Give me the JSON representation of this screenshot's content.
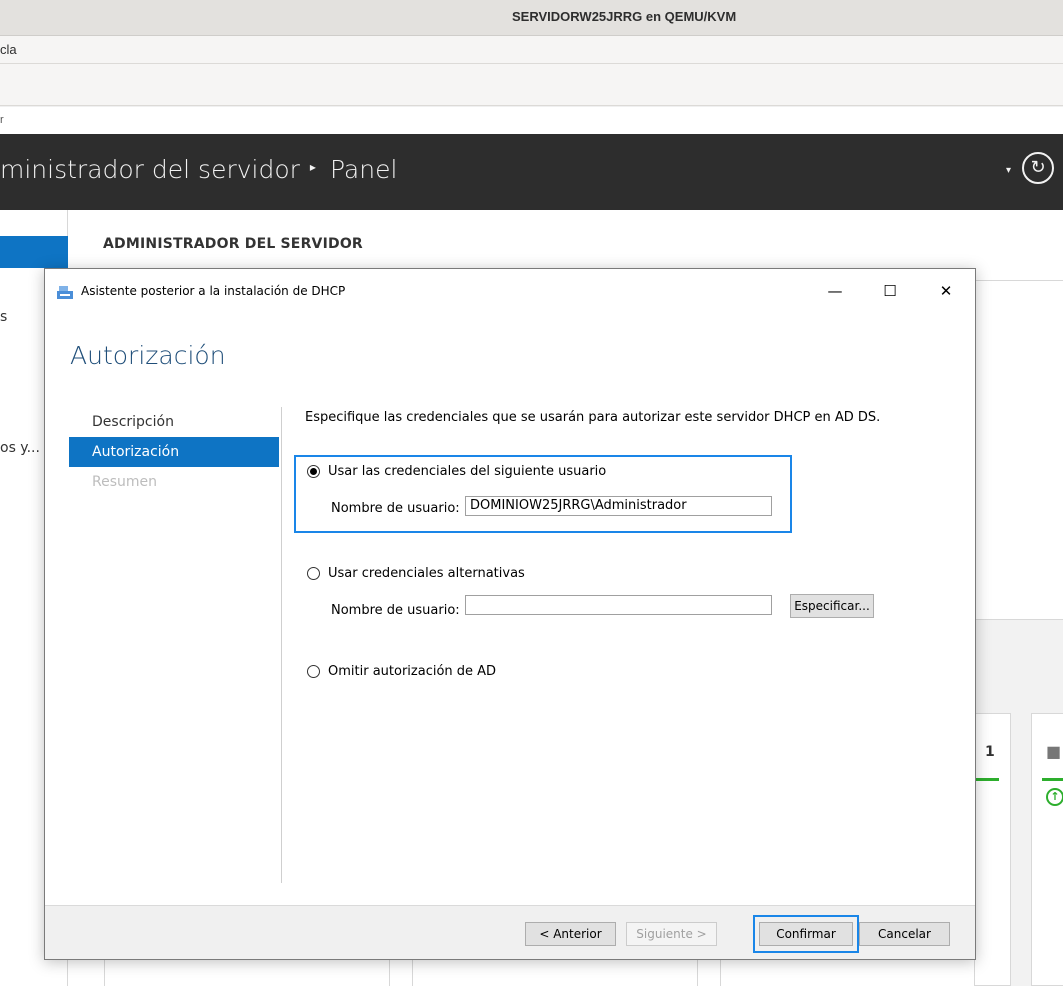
{
  "vm": {
    "window_title": "SERVIDORW25JRRG en QEMU/KVM",
    "menu_visible_text": "cla",
    "titlestrip_text": "r"
  },
  "server_manager": {
    "breadcrumb_root": "ministrador del servidor",
    "breadcrumb_sep": "▸",
    "breadcrumb_page": "Panel",
    "main_title": "ADMINISTRADOR DEL SERVIDOR",
    "nav_fragment_1": "s",
    "nav_fragment_2": "os y...",
    "tile_number": "1",
    "header_arrow": "▾",
    "refresh_glyph": "↻",
    "tile_up_glyph": "↑"
  },
  "dialog": {
    "title": "Asistente posterior a la instalación de DHCP",
    "minimize_glyph": "—",
    "maximize_glyph": "☐",
    "close_glyph": "✕",
    "heading": "Autorización",
    "steps": [
      {
        "label": "Descripción",
        "state": "normal"
      },
      {
        "label": "Autorización",
        "state": "active"
      },
      {
        "label": "Resumen",
        "state": "disabled"
      }
    ],
    "description": "Especifique las credenciales que se usarán para autorizar este servidor DHCP en AD DS.",
    "options": {
      "current_user": {
        "label": "Usar las credenciales del siguiente usuario",
        "checked": true,
        "username_label": "Nombre de usuario:",
        "username_value": "DOMINIOW25JRRG\\Administrador"
      },
      "alternate": {
        "label": "Usar credenciales alternativas",
        "checked": false,
        "username_label": "Nombre de usuario:",
        "username_value": "",
        "specify_button": "Especificar..."
      },
      "skip": {
        "label": "Omitir autorización de AD",
        "checked": false
      }
    },
    "footer": {
      "back": "< Anterior",
      "next": "Siguiente >",
      "commit": "Confirmar",
      "cancel": "Cancelar"
    }
  },
  "colors": {
    "accent_blue": "#0e74c4",
    "focus_blue": "#1a86e8",
    "header_dark": "#2d2d2d",
    "heading_blue": "#1f4e79",
    "status_green": "#2dae2d"
  }
}
